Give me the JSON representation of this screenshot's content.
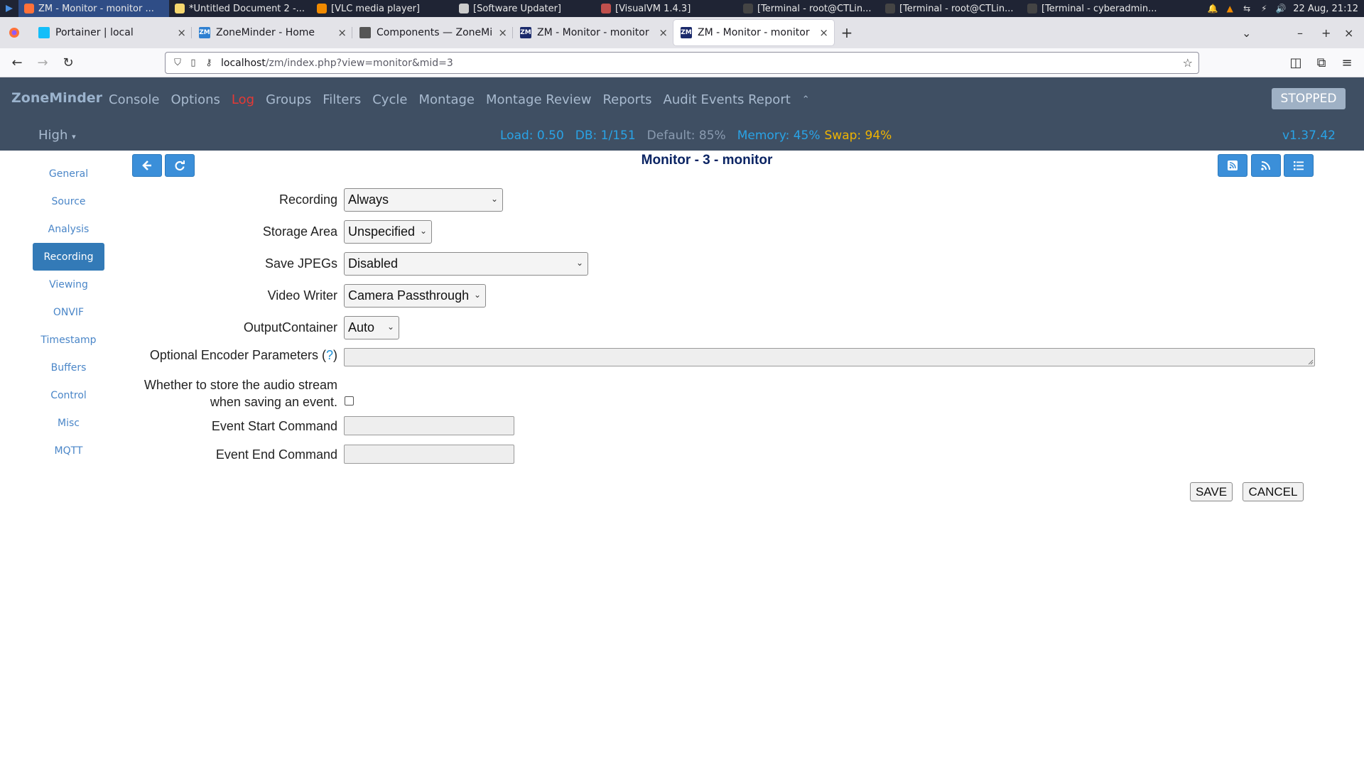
{
  "os_taskbar": {
    "tasks": [
      {
        "label": "ZM - Monitor - monitor ...",
        "icon": "firefox-icon",
        "color": "#ff7139",
        "active": true
      },
      {
        "label": "*Untitled Document 2 -...",
        "icon": "text-editor-icon",
        "color": "#f5d76e"
      },
      {
        "label": "[VLC media player]",
        "icon": "vlc-icon",
        "color": "#f08a00"
      },
      {
        "label": "[Software Updater]",
        "icon": "refresh-icon",
        "color": "#cccccc"
      },
      {
        "label": "[VisualVM 1.4.3]",
        "icon": "visualvm-icon",
        "color": "#c0504d"
      },
      {
        "label": "[Terminal - root@CTLin...",
        "icon": "terminal-icon",
        "color": "#444444"
      },
      {
        "label": "[Terminal - root@CTLin...",
        "icon": "terminal-icon",
        "color": "#444444"
      },
      {
        "label": "[Terminal - cyberadmin...",
        "icon": "terminal-icon",
        "color": "#444444"
      }
    ],
    "clock": "22 Aug, 21:12"
  },
  "browser": {
    "tabs": [
      {
        "title": "Portainer | local",
        "favicon": "portainer-icon",
        "favicon_color": "#13bef9"
      },
      {
        "title": "ZoneMinder - Home",
        "favicon": "zm-icon",
        "favicon_color": "#2f80d1",
        "favicon_text": "ZM"
      },
      {
        "title": "Components — ZoneMin",
        "favicon": "docs-icon",
        "favicon_color": "#555555"
      },
      {
        "title": "ZM - Monitor - monitor",
        "favicon": "zm-icon",
        "favicon_color": "#1b2a6b",
        "favicon_text": "ZM"
      },
      {
        "title": "ZM - Monitor - monitor",
        "favicon": "zm-icon",
        "favicon_color": "#1b2a6b",
        "favicon_text": "ZM",
        "selected": true
      }
    ],
    "url_host": "localhost",
    "url_path": "/zm/index.php?view=monitor&mid=3"
  },
  "zm": {
    "brand": "ZoneMinder",
    "menu": [
      "Console",
      "Options",
      "Log",
      "Groups",
      "Filters",
      "Cycle",
      "Montage",
      "Montage Review",
      "Reports",
      "Audit Events Report"
    ],
    "state_button": "STOPPED",
    "bandwidth": "High",
    "status": {
      "load": "Load: 0.50",
      "db": "DB: 1/151",
      "default": "Default: 85%",
      "memory": "Memory: 45%",
      "swap": "Swap: 94%"
    },
    "version": "v1.37.42"
  },
  "sidebar": {
    "items": [
      "General",
      "Source",
      "Analysis",
      "Recording",
      "Viewing",
      "ONVIF",
      "Timestamp",
      "Buffers",
      "Control",
      "Misc",
      "MQTT"
    ],
    "active": "Recording"
  },
  "page": {
    "title": "Monitor - 3 - monitor"
  },
  "form": {
    "recording": {
      "label": "Recording",
      "value": "Always"
    },
    "storage_area": {
      "label": "Storage Area",
      "value": "Unspecified"
    },
    "save_jpegs": {
      "label": "Save JPEGs",
      "value": "Disabled"
    },
    "video_writer": {
      "label": "Video Writer",
      "value": "Camera Passthrough"
    },
    "output_container": {
      "label": "OutputContainer",
      "value": "Auto"
    },
    "encoder_params": {
      "label": "Optional Encoder Parameters (",
      "help": "?",
      "label_end": ")",
      "value": ""
    },
    "audio": {
      "label_line1": "Whether to store the audio stream",
      "label_line2": "when saving an event.",
      "checked": false
    },
    "event_start": {
      "label": "Event Start Command",
      "value": ""
    },
    "event_end": {
      "label": "Event End Command",
      "value": ""
    },
    "save_label": "SAVE",
    "cancel_label": "CANCEL"
  }
}
